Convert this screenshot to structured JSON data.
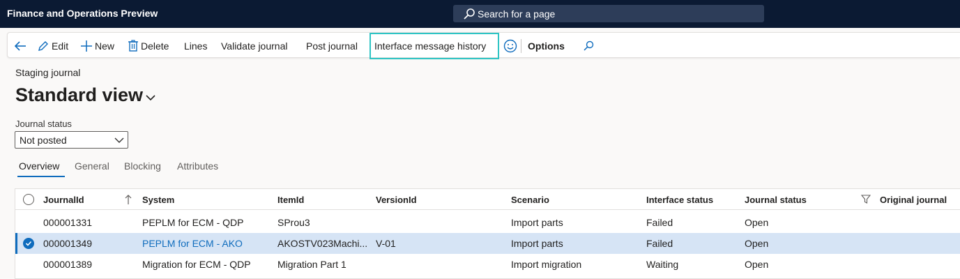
{
  "app": {
    "title": "Finance and Operations Preview"
  },
  "search": {
    "placeholder": "Search for a page"
  },
  "actions": {
    "edit": "Edit",
    "new": "New",
    "delete": "Delete",
    "lines": "Lines",
    "validate": "Validate journal",
    "post": "Post journal",
    "interface_history": "Interface message history",
    "options": "Options"
  },
  "page": {
    "breadcrumb": "Staging journal",
    "view_title": "Standard view"
  },
  "filter": {
    "label": "Journal status",
    "value": "Not posted"
  },
  "tabs": [
    "Overview",
    "General",
    "Blocking",
    "Attributes"
  ],
  "grid": {
    "columns": [
      "JournalId",
      "System",
      "ItemId",
      "VersionId",
      "Scenario",
      "Interface status",
      "Journal status",
      "Original journal"
    ],
    "rows": [
      {
        "journal_id": "000001331",
        "system": "PEPLM for ECM - QDP",
        "item_id": "SProu3",
        "version_id": "",
        "scenario": "Import parts",
        "interface_status": "Failed",
        "journal_status": "Open",
        "selected": false
      },
      {
        "journal_id": "000001349",
        "system": "PEPLM for ECM - AKO",
        "item_id": "AKOSTV023Machi...",
        "version_id": "V-01",
        "scenario": "Import parts",
        "interface_status": "Failed",
        "journal_status": "Open",
        "selected": true
      },
      {
        "journal_id": "000001389",
        "system": "Migration for ECM - QDP",
        "item_id": "Migration Part 1",
        "version_id": "",
        "scenario": "Import migration",
        "interface_status": "Waiting",
        "journal_status": "Open",
        "selected": false
      }
    ]
  },
  "colors": {
    "topbar": "#0b1a33",
    "accent": "#0f6cbd",
    "highlight": "#2ec4c4",
    "selected_row": "#d6e4f5"
  }
}
